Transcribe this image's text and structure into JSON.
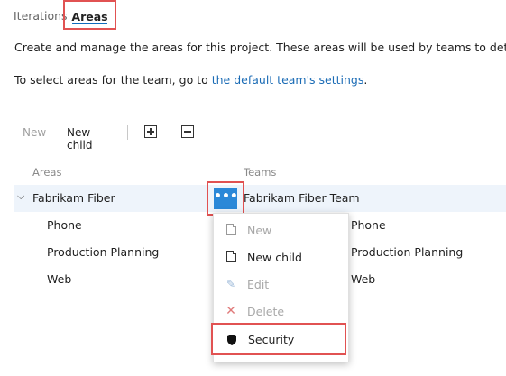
{
  "tabs": [
    {
      "label": "Iterations"
    },
    {
      "label": "Areas"
    }
  ],
  "description": {
    "line1": "Create and manage the areas for this project. These areas will be used by teams to deterr",
    "line2_prefix": "To select areas for the team, go to ",
    "line2_link": "the default team's settings",
    "line2_suffix": "."
  },
  "toolbar": {
    "new_label": "New",
    "new_child_label": "New child"
  },
  "table": {
    "columns": [
      "Areas",
      "Teams"
    ],
    "rows": [
      {
        "area": "Fabrikam Fiber",
        "team": "Fabrikam Fiber Team"
      },
      {
        "area": "Phone",
        "team": ", Phone"
      },
      {
        "area": "Production Planning",
        "team": ", Production Planning"
      },
      {
        "area": "Web",
        "team": ", Web"
      }
    ]
  },
  "more_button": {
    "label": "•••"
  },
  "context_menu": {
    "items": [
      {
        "label": "New",
        "icon": "new-doc-icon",
        "disabled": true
      },
      {
        "label": "New child",
        "icon": "new-child-doc-icon",
        "disabled": false
      },
      {
        "label": "Edit",
        "icon": "pencil-icon",
        "disabled": true
      },
      {
        "label": "Delete",
        "icon": "x-icon",
        "disabled": true
      },
      {
        "label": "Security",
        "icon": "shield-icon",
        "disabled": false
      }
    ]
  },
  "colors": {
    "accent": "#2b88d8",
    "highlight_border": "#e15252",
    "link": "#1a6bb5",
    "selected_row": "#eef4fb"
  }
}
